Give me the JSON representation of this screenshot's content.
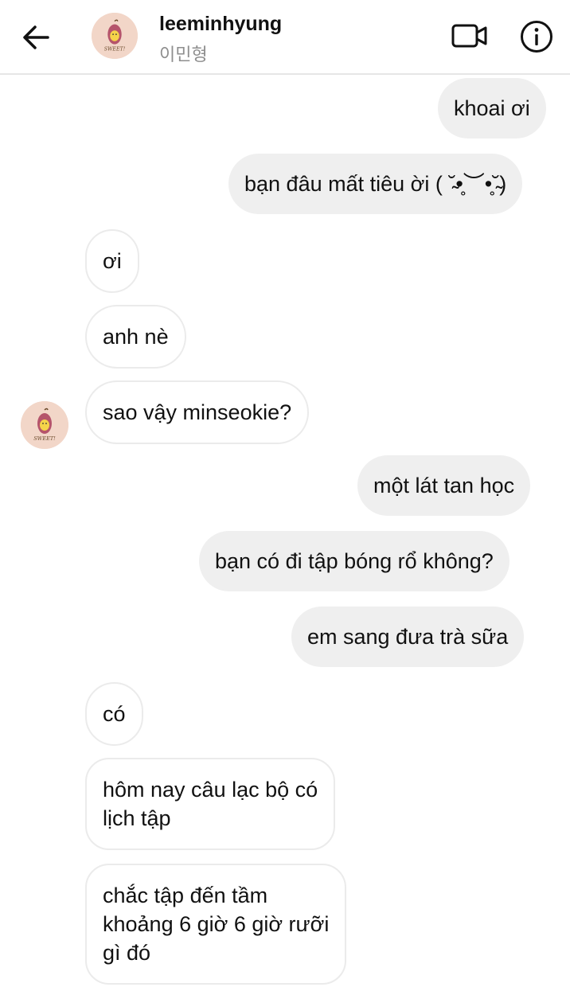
{
  "header": {
    "username": "leeminhyung",
    "subname": "이민형",
    "avatar_text": "SWEET!"
  },
  "icons": {
    "back": "arrow-left-icon",
    "video": "video-camera-icon",
    "info": "info-circle-icon"
  },
  "colors": {
    "sent_bubble": "#efefef",
    "received_border": "#ebebeb",
    "avatar_bg": "#f2d6c8"
  },
  "messages": [
    {
      "side": "sent",
      "text": "khoai ơi"
    },
    {
      "side": "sent",
      "text": "bạn đâu mất tiêu ời ( ˘̴•̥︶•̥˘̴)"
    },
    {
      "side": "received",
      "text": "ơi"
    },
    {
      "side": "received",
      "text": "anh nè"
    },
    {
      "side": "received",
      "text": "sao vậy minseokie?"
    },
    {
      "side": "sent",
      "text": "một lát tan học"
    },
    {
      "side": "sent",
      "text": "bạn có đi tập bóng rổ không?"
    },
    {
      "side": "sent",
      "text": "em sang đưa trà sữa"
    },
    {
      "side": "received",
      "text": "có"
    },
    {
      "side": "received",
      "text": "hôm nay câu lạc bộ có\nlịch tập"
    },
    {
      "side": "received",
      "text": "chắc tập đến tầm\nkhoảng 6 giờ 6 giờ rưỡi\ngì đó"
    }
  ]
}
